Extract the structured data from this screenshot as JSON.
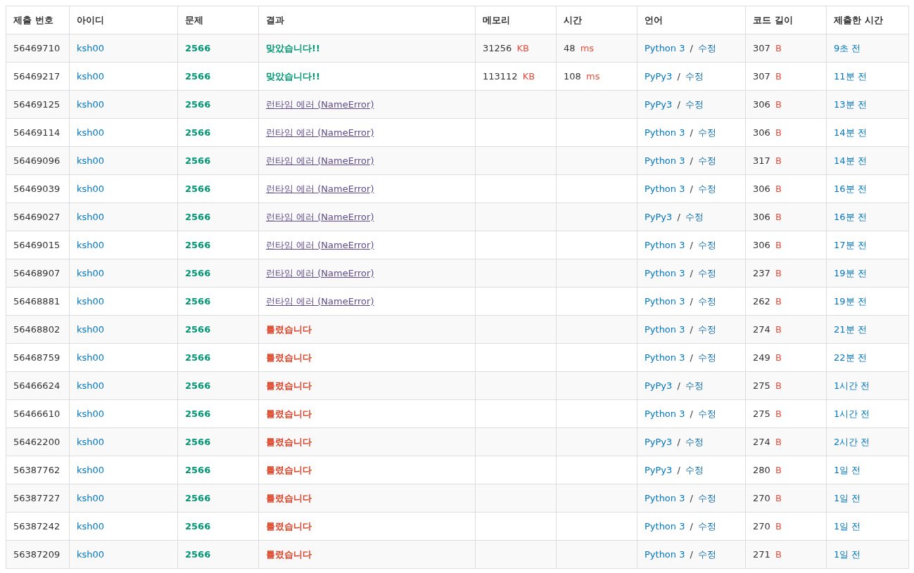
{
  "table": {
    "columns": [
      "제출 번호",
      "아이디",
      "문제",
      "결과",
      "메모리",
      "시간",
      "언어",
      "코드 길이",
      "제출한 시간"
    ],
    "rows": [
      {
        "id": "56469710",
        "user": "ksh00",
        "problem": "2566",
        "result": {
          "kind": "ac",
          "text": "맞았습니다!!"
        },
        "memory": "31256",
        "memory_unit": "KB",
        "time": "48",
        "time_unit": "ms",
        "language": "Python 3",
        "separator": "/",
        "edit": "수정",
        "length": "307",
        "length_unit": "B",
        "submitted": "9초 전"
      },
      {
        "id": "56469217",
        "user": "ksh00",
        "problem": "2566",
        "result": {
          "kind": "ac",
          "text": "맞았습니다!!"
        },
        "memory": "113112",
        "memory_unit": "KB",
        "time": "108",
        "time_unit": "ms",
        "language": "PyPy3",
        "separator": "/",
        "edit": "수정",
        "length": "307",
        "length_unit": "B",
        "submitted": "11분 전"
      },
      {
        "id": "56469125",
        "user": "ksh00",
        "problem": "2566",
        "result": {
          "kind": "re",
          "text": "런타임 에러 (NameError)"
        },
        "language": "PyPy3",
        "separator": "/",
        "edit": "수정",
        "length": "306",
        "length_unit": "B",
        "submitted": "13분 전"
      },
      {
        "id": "56469114",
        "user": "ksh00",
        "problem": "2566",
        "result": {
          "kind": "re",
          "text": "런타임 에러 (NameError)"
        },
        "language": "Python 3",
        "separator": "/",
        "edit": "수정",
        "length": "306",
        "length_unit": "B",
        "submitted": "14분 전"
      },
      {
        "id": "56469096",
        "user": "ksh00",
        "problem": "2566",
        "result": {
          "kind": "re",
          "text": "런타임 에러 (NameError)"
        },
        "language": "Python 3",
        "separator": "/",
        "edit": "수정",
        "length": "317",
        "length_unit": "B",
        "submitted": "14분 전"
      },
      {
        "id": "56469039",
        "user": "ksh00",
        "problem": "2566",
        "result": {
          "kind": "re",
          "text": "런타임 에러 (NameError)"
        },
        "language": "Python 3",
        "separator": "/",
        "edit": "수정",
        "length": "306",
        "length_unit": "B",
        "submitted": "16분 전"
      },
      {
        "id": "56469027",
        "user": "ksh00",
        "problem": "2566",
        "result": {
          "kind": "re",
          "text": "런타임 에러 (NameError)"
        },
        "language": "PyPy3",
        "separator": "/",
        "edit": "수정",
        "length": "306",
        "length_unit": "B",
        "submitted": "16분 전"
      },
      {
        "id": "56469015",
        "user": "ksh00",
        "problem": "2566",
        "result": {
          "kind": "re",
          "text": "런타임 에러 (NameError)"
        },
        "language": "Python 3",
        "separator": "/",
        "edit": "수정",
        "length": "306",
        "length_unit": "B",
        "submitted": "17분 전"
      },
      {
        "id": "56468907",
        "user": "ksh00",
        "problem": "2566",
        "result": {
          "kind": "re",
          "text": "런타임 에러 (NameError)"
        },
        "language": "Python 3",
        "separator": "/",
        "edit": "수정",
        "length": "237",
        "length_unit": "B",
        "submitted": "19분 전"
      },
      {
        "id": "56468881",
        "user": "ksh00",
        "problem": "2566",
        "result": {
          "kind": "re",
          "text": "런타임 에러 (NameError)"
        },
        "language": "Python 3",
        "separator": "/",
        "edit": "수정",
        "length": "262",
        "length_unit": "B",
        "submitted": "19분 전"
      },
      {
        "id": "56468802",
        "user": "ksh00",
        "problem": "2566",
        "result": {
          "kind": "wa",
          "text": "틀렸습니다"
        },
        "language": "Python 3",
        "separator": "/",
        "edit": "수정",
        "length": "274",
        "length_unit": "B",
        "submitted": "21분 전"
      },
      {
        "id": "56468759",
        "user": "ksh00",
        "problem": "2566",
        "result": {
          "kind": "wa",
          "text": "틀렸습니다"
        },
        "language": "Python 3",
        "separator": "/",
        "edit": "수정",
        "length": "249",
        "length_unit": "B",
        "submitted": "22분 전"
      },
      {
        "id": "56466624",
        "user": "ksh00",
        "problem": "2566",
        "result": {
          "kind": "wa",
          "text": "틀렸습니다"
        },
        "language": "PyPy3",
        "separator": "/",
        "edit": "수정",
        "length": "275",
        "length_unit": "B",
        "submitted": "1시간 전"
      },
      {
        "id": "56466610",
        "user": "ksh00",
        "problem": "2566",
        "result": {
          "kind": "wa",
          "text": "틀렸습니다"
        },
        "language": "Python 3",
        "separator": "/",
        "edit": "수정",
        "length": "275",
        "length_unit": "B",
        "submitted": "1시간 전"
      },
      {
        "id": "56462200",
        "user": "ksh00",
        "problem": "2566",
        "result": {
          "kind": "wa",
          "text": "틀렸습니다"
        },
        "language": "PyPy3",
        "separator": "/",
        "edit": "수정",
        "length": "274",
        "length_unit": "B",
        "submitted": "2시간 전"
      },
      {
        "id": "56387762",
        "user": "ksh00",
        "problem": "2566",
        "result": {
          "kind": "wa",
          "text": "틀렸습니다"
        },
        "language": "PyPy3",
        "separator": "/",
        "edit": "수정",
        "length": "280",
        "length_unit": "B",
        "submitted": "1일 전"
      },
      {
        "id": "56387727",
        "user": "ksh00",
        "problem": "2566",
        "result": {
          "kind": "wa",
          "text": "틀렸습니다"
        },
        "language": "Python 3",
        "separator": "/",
        "edit": "수정",
        "length": "270",
        "length_unit": "B",
        "submitted": "1일 전"
      },
      {
        "id": "56387242",
        "user": "ksh00",
        "problem": "2566",
        "result": {
          "kind": "wa",
          "text": "틀렸습니다"
        },
        "language": "Python 3",
        "separator": "/",
        "edit": "수정",
        "length": "270",
        "length_unit": "B",
        "submitted": "1일 전"
      },
      {
        "id": "56387209",
        "user": "ksh00",
        "problem": "2566",
        "result": {
          "kind": "wa",
          "text": "틀렸습니다"
        },
        "language": "Python 3",
        "separator": "/",
        "edit": "수정",
        "length": "271",
        "length_unit": "B",
        "submitted": "1일 전"
      }
    ]
  }
}
